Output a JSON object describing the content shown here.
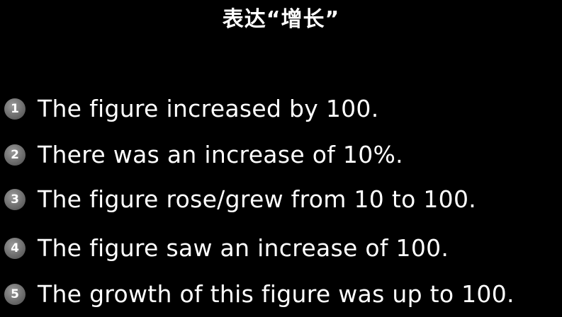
{
  "title": "表达“增长”",
  "items": [
    {
      "number": "1",
      "text": "The figure increased by 100."
    },
    {
      "number": "2",
      "text": "There was an increase of 10%."
    },
    {
      "number": "3",
      "text": "The figure rose/grew from 10 to 100."
    },
    {
      "number": "4",
      "text": "The figure saw an increase of 100."
    },
    {
      "number": "5",
      "text": "The growth of this figure was up to 100."
    }
  ],
  "colors": {
    "background": "#000000",
    "text": "#ffffff",
    "number_badge": "#6e6e6e"
  }
}
